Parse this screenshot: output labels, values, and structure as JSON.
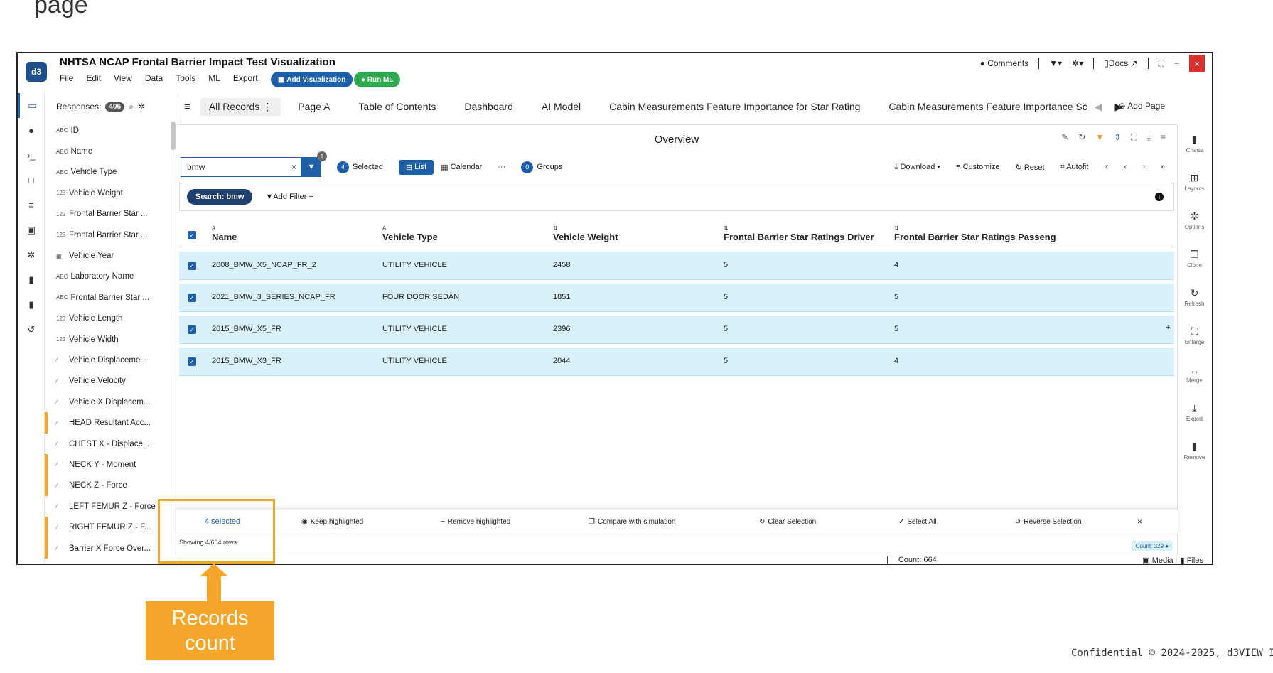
{
  "slide": {
    "top_text": "page",
    "callout": "Records count",
    "confidential": "Confidential © 2024-2025, d3VIEW In"
  },
  "app": {
    "title": "NHTSA NCAP Frontal Barrier Impact Test Visualization",
    "menu": [
      "File",
      "Edit",
      "View",
      "Data",
      "Tools",
      "ML",
      "Export"
    ],
    "add_viz": "Add Visualization",
    "run_ml": "Run ML",
    "comments": "Comments",
    "docs": "Docs",
    "close": "×"
  },
  "fields_panel": {
    "label": "Responses:",
    "count": "406",
    "items": [
      {
        "type": "ABC",
        "label": "ID",
        "mark": false
      },
      {
        "type": "ABC",
        "label": "Name",
        "mark": false
      },
      {
        "type": "ABC",
        "label": "Vehicle Type",
        "mark": false
      },
      {
        "type": "123",
        "label": "Vehicle Weight",
        "mark": false
      },
      {
        "type": "123",
        "label": "Frontal Barrier Star ...",
        "mark": false
      },
      {
        "type": "123",
        "label": "Frontal Barrier Star ...",
        "mark": false
      },
      {
        "type": "▦",
        "label": "Vehicle Year",
        "mark": false
      },
      {
        "type": "ABC",
        "label": "Laboratory Name",
        "mark": false
      },
      {
        "type": "ABC",
        "label": "Frontal Barrier Star ...",
        "mark": false
      },
      {
        "type": "123",
        "label": "Vehicle Length",
        "mark": false
      },
      {
        "type": "123",
        "label": "Vehicle Width",
        "mark": false
      },
      {
        "type": "∕",
        "label": "Vehicle Displaceme...",
        "mark": false
      },
      {
        "type": "∕",
        "label": "Vehicle Velocity",
        "mark": false
      },
      {
        "type": "∕",
        "label": "Vehicle X Displacem...",
        "mark": false
      },
      {
        "type": "∕",
        "label": "HEAD Resultant Acc...",
        "mark": true
      },
      {
        "type": "∕",
        "label": "CHEST X - Displace...",
        "mark": false
      },
      {
        "type": "∕",
        "label": "NECK Y - Moment",
        "mark": true
      },
      {
        "type": "∕",
        "label": "NECK Z - Force",
        "mark": true
      },
      {
        "type": "∕",
        "label": "LEFT FEMUR Z - Force",
        "mark": false
      },
      {
        "type": "∕",
        "label": "RIGHT FEMUR Z - F...",
        "mark": true
      },
      {
        "type": "∕",
        "label": "Barrier X Force Over...",
        "mark": true
      }
    ]
  },
  "tabs": {
    "items": [
      "All Records",
      "Page A",
      "Table of Contents",
      "Dashboard",
      "AI Model",
      "Cabin Measurements Feature Importance for Star Rating",
      "Cabin Measurements Feature Importance Sc"
    ],
    "add_page": "Add Page"
  },
  "right_tools": [
    "Charts",
    "Layouts",
    "Options",
    "Clone",
    "Refresh",
    "Enlarge",
    "Merge",
    "Export",
    "Remove"
  ],
  "card": {
    "title": "Overview",
    "search_value": "bmw",
    "filter_count": "1",
    "selected_count": "4",
    "selected_label": "Selected",
    "list_label": "List",
    "calendar_label": "Calendar",
    "more_label": "···",
    "groups_count": "0",
    "groups_label": "Groups",
    "download": "Download",
    "customize": "Customize",
    "reset": "Reset",
    "autofit": "Autofit",
    "search_chip": "Search: bmw",
    "add_filter": "Add Filter",
    "columns": [
      {
        "type": "A",
        "label": "Name"
      },
      {
        "type": "A",
        "label": "Vehicle Type"
      },
      {
        "type": "⇅",
        "label": "Vehicle Weight"
      },
      {
        "type": "⇅",
        "label": "Frontal Barrier Star Ratings Driver"
      },
      {
        "type": "⇅",
        "label": "Frontal Barrier Star Ratings Passeng"
      }
    ],
    "rows": [
      [
        "2008_BMW_X5_NCAP_FR_2",
        "UTILITY VEHICLE",
        "2458",
        "5",
        "4"
      ],
      [
        "2021_BMW_3_SERIES_NCAP_FR",
        "FOUR DOOR SEDAN",
        "1851",
        "5",
        "5"
      ],
      [
        "2015_BMW_X5_FR",
        "UTILITY VEHICLE",
        "2396",
        "5",
        "5"
      ],
      [
        "2015_BMW_X3_FR",
        "UTILITY VEHICLE",
        "2044",
        "5",
        "4"
      ]
    ],
    "selection": {
      "count_text": "4 selected",
      "keep": "Keep highlighted",
      "remove": "Remove highlighted",
      "compare": "Compare with simulation",
      "clear": "Clear Selection",
      "select_all": "Select All",
      "reverse": "Reverse Selection"
    },
    "showing": "Showing 4/664 rows.",
    "count_chip": "Count: 329"
  },
  "status": {
    "count": "Count: 664",
    "media": "Media",
    "files": "Files"
  },
  "colors": {
    "accent": "#1f5fa8",
    "highlight": "#f4a62a",
    "row_bg": "#d9f1fa"
  }
}
